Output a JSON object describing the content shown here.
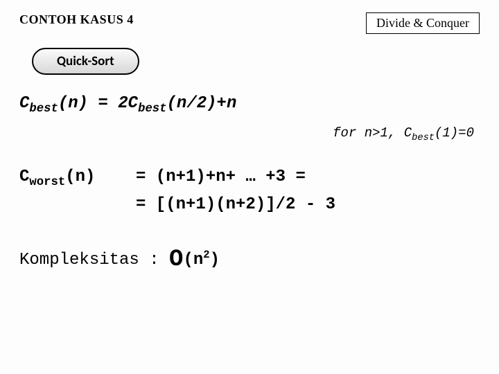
{
  "header": {
    "left_title": "CONTOH KASUS 4",
    "right_box": "Divide & Conquer"
  },
  "pill_label": "Quick-Sort",
  "best": {
    "lhs_c": "C",
    "lhs_sub": "best",
    "lhs_arg": "(n) = 2C",
    "rhs_sub": "best",
    "rhs_tail": "(n/2)+n"
  },
  "note": {
    "pre": "for n>1, C",
    "sub": "best",
    "post": "(1)=0"
  },
  "worst": {
    "lhs_c": "C",
    "lhs_sub": "worst",
    "lhs_arg": "(n)",
    "line1_rhs": "= (n+1)+n+ … +3 =",
    "line2_rhs": "= [(n+1)(n+2)]/2 - 3"
  },
  "complexity": {
    "label": "Kompleksitas : ",
    "bigO": "O",
    "open": "(n",
    "exp": "2",
    "close": ")"
  }
}
